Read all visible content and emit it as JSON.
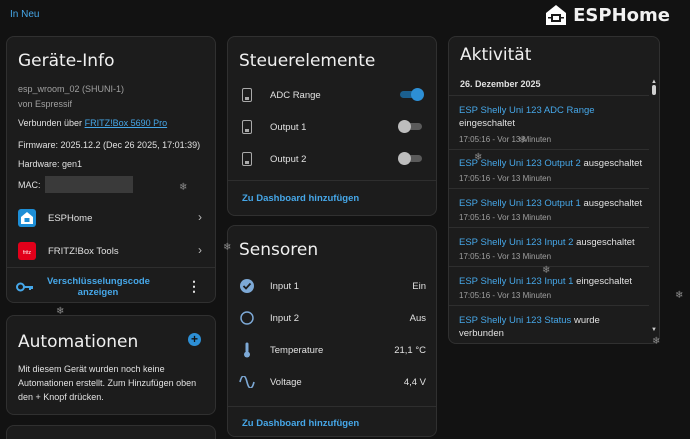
{
  "header": {
    "breadcrumb": "In Neu",
    "brand": "ESPHome"
  },
  "device_info": {
    "title": "Geräte-Info",
    "device_name": "esp_wroom_02 (SHUNI-1)",
    "manufacturer": "von Espressif",
    "connected_prefix": "Verbunden über",
    "connected_link": "FRITZ!Box 5690 Pro",
    "firmware": "Firmware: 2025.12.2 (Dec 26 2025, 17:01:39)",
    "hardware": "Hardware: gen1",
    "mac_label": "MAC:",
    "integrations": [
      {
        "label": "ESPHome",
        "icon": "esphome-icon"
      },
      {
        "label": "FRITZ!Box Tools",
        "icon": "fritzbox-icon"
      }
    ],
    "key_button": "Verschlüsselungscode anzeigen"
  },
  "automations": {
    "title": "Automationen",
    "text": "Mit diesem Gerät wurden noch keine Automationen erstellt. Zum Hinzufügen oben den + Knopf drücken."
  },
  "controls": {
    "title": "Steuerelemente",
    "items": [
      {
        "label": "ADC Range",
        "on": true
      },
      {
        "label": "Output 1",
        "on": false
      },
      {
        "label": "Output 2",
        "on": false
      }
    ],
    "add_button": "Zu Dashboard hinzufügen"
  },
  "sensors": {
    "title": "Sensoren",
    "items": [
      {
        "label": "Input 1",
        "value": "Ein",
        "icon": "check-circle-icon"
      },
      {
        "label": "Input 2",
        "value": "Aus",
        "icon": "circle-outline-icon"
      },
      {
        "label": "Temperature",
        "value": "21,1 °C",
        "icon": "thermometer-icon"
      },
      {
        "label": "Voltage",
        "value": "4,4 V",
        "icon": "sine-wave-icon"
      }
    ],
    "add_button": "Zu Dashboard hinzufügen"
  },
  "activity": {
    "title": "Aktivität",
    "date": "26. Dezember 2025",
    "entries": [
      {
        "entity": "ESP Shelly Uni 123 ADC Range",
        "action": "eingeschaltet",
        "time": "17:05:16 - Vor 13 Minuten"
      },
      {
        "entity": "ESP Shelly Uni 123 Output 2",
        "action": "ausgeschaltet",
        "time": "17:05:16 - Vor 13 Minuten"
      },
      {
        "entity": "ESP Shelly Uni 123 Output 1",
        "action": "ausgeschaltet",
        "time": "17:05:16 - Vor 13 Minuten"
      },
      {
        "entity": "ESP Shelly Uni 123 Input 2",
        "action": "ausgeschaltet",
        "time": "17:05:16 - Vor 13 Minuten"
      },
      {
        "entity": "ESP Shelly Uni 123 Input 1",
        "action": "eingeschaltet",
        "time": "17:05:16 - Vor 13 Minuten"
      },
      {
        "entity": "ESP Shelly Uni 123 Status",
        "action": "wurde verbunden",
        "time": ""
      }
    ]
  },
  "colors": {
    "accent": "#46a7e8",
    "toggle_on": "#2d8fd5",
    "card_bg": "#1c1c1c",
    "page_bg": "#121212"
  }
}
